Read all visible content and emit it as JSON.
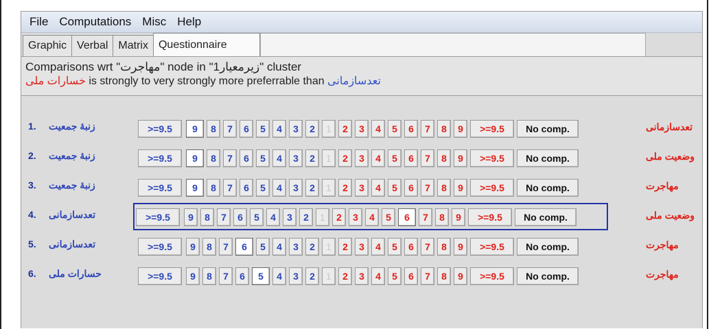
{
  "menu": [
    "File",
    "Computations",
    "Misc",
    "Help"
  ],
  "tabs": [
    "Graphic",
    "Verbal",
    "Matrix",
    "Questionnaire"
  ],
  "header": {
    "line1": "Comparisons wrt \"مهاجرت\" node in \"زیرمعیار1\" cluster",
    "line2_left": "خسارات ملی",
    "line2_mid": " is strongly to very strongly more preferrable than ",
    "line2_right": "تعدسازمانی"
  },
  "scale": {
    "left": [
      ">=9.5",
      "9",
      "8",
      "7",
      "6",
      "5",
      "4",
      "3",
      "2"
    ],
    "one": "1",
    "right": [
      "2",
      "3",
      "4",
      "5",
      "6",
      "7",
      "8",
      "9",
      ">=9.5"
    ],
    "no_comp": "No comp."
  },
  "rows": [
    {
      "num": "1.",
      "left": "زنبۀ جمعیت",
      "right": "تعدسازمانی",
      "selected_side": "left",
      "selected_value": "9"
    },
    {
      "num": "2.",
      "left": "زنبۀ جمعیت",
      "right": "وضعیت ملی",
      "selected_side": "left",
      "selected_value": "9"
    },
    {
      "num": "3.",
      "left": "زنبۀ جمعیت",
      "right": "مهاجرت",
      "selected_side": "left",
      "selected_value": "9"
    },
    {
      "num": "4.",
      "left": "تعدسازمانی",
      "right": "وضعیت ملی",
      "selected_side": "right",
      "selected_value": "6"
    },
    {
      "num": "5.",
      "left": "تعدسازمانی",
      "right": "مهاجرت",
      "selected_side": "left",
      "selected_value": "6"
    },
    {
      "num": "6.",
      "left": "حسارات ملی",
      "right": "مهاجرت",
      "selected_side": "left",
      "selected_value": "5"
    }
  ],
  "selected_row": 3,
  "colors": {
    "left_side": "#2c46b8",
    "right_side": "#e0201a",
    "selection_border": "#2234a8"
  }
}
